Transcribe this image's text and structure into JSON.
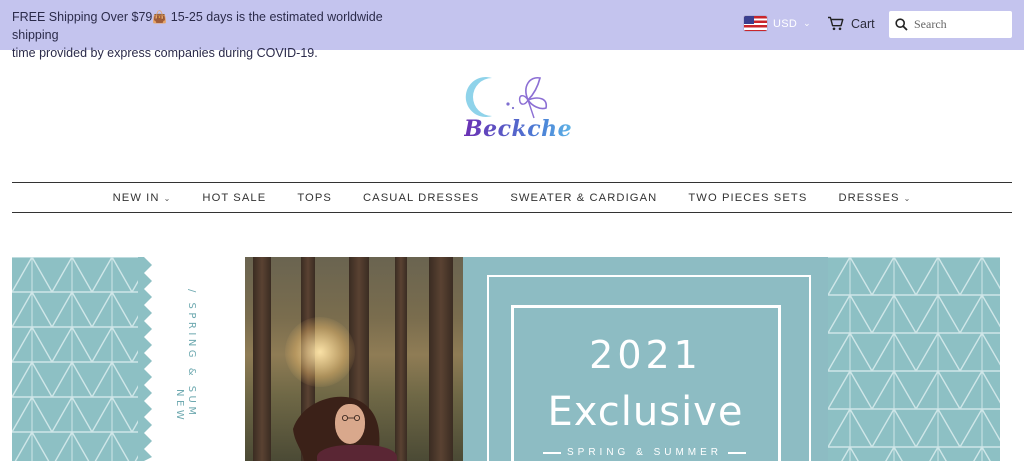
{
  "topbar": {
    "announcement_line1_a": "FREE Shipping Over $79",
    "announcement_line1_b": "15-25 days is the estimated worldwide shipping",
    "announcement_line2": "time provided by express companies during COVID-19.",
    "currency": "USD",
    "cart_label": "Cart",
    "search_placeholder": "Search"
  },
  "logo": {
    "text": "Beckche"
  },
  "nav": {
    "items": [
      {
        "label": "NEW IN",
        "dropdown": true
      },
      {
        "label": "HOT SALE"
      },
      {
        "label": "TOPS"
      },
      {
        "label": "CASUAL DRESSES"
      },
      {
        "label": "SWEATER & CARDIGAN"
      },
      {
        "label": "TWO PIECES SETS"
      },
      {
        "label": "DRESSES",
        "dropdown": true
      }
    ]
  },
  "banner": {
    "vertical_text_a": "/ SPRING & SUM",
    "vertical_text_b": "NEW",
    "year": "2021",
    "headline": "Exclusive",
    "subline": "SPRING & SUMMER"
  },
  "colors": {
    "topbar_bg": "#c4c4ee",
    "banner_teal": "#8dbcc3"
  },
  "icons": {
    "flag": "us-flag-icon",
    "cart": "cart-icon",
    "search": "search-icon",
    "caret": "chevron-down-icon"
  }
}
